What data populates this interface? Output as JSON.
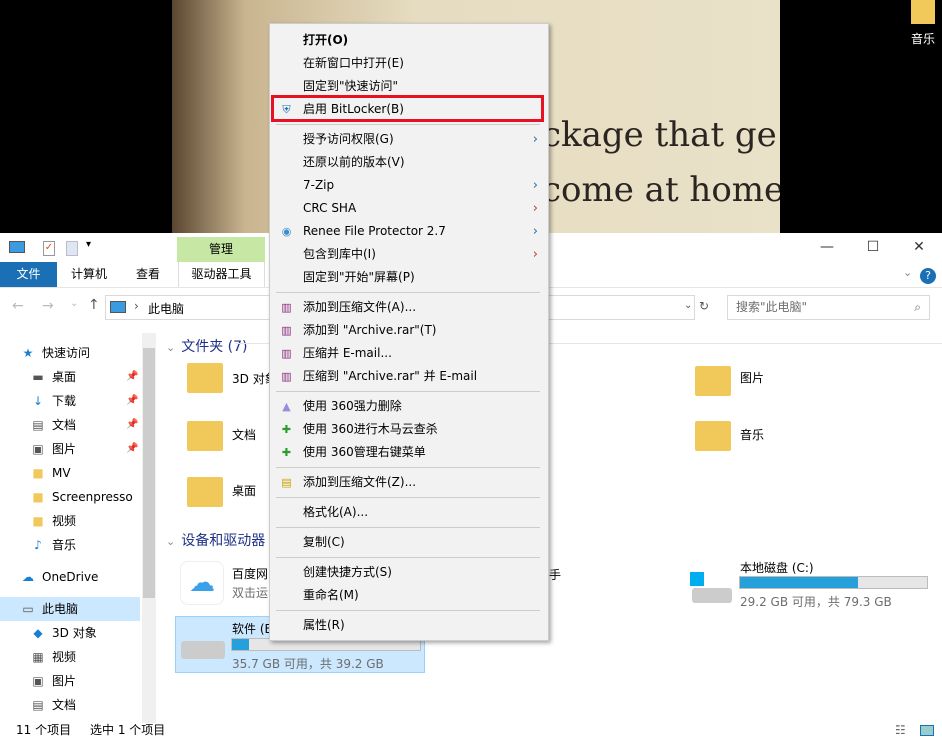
{
  "desktop": {
    "photo_text_1": "ckage that ge",
    "photo_text_2": "come at home",
    "icon_label": "音乐"
  },
  "window": {
    "ribbon": {
      "context_tab": "管理",
      "tabs": [
        "文件",
        "计算机",
        "查看",
        "驱动器工具"
      ]
    },
    "address": {
      "path": "此电脑",
      "search_placeholder": "搜索\"此电脑\""
    },
    "nav": [
      {
        "label": "快速访问",
        "icon": "star-icon"
      },
      {
        "label": "桌面",
        "icon": "desktop-icon",
        "pinned": true
      },
      {
        "label": "下载",
        "icon": "download-icon",
        "pinned": true
      },
      {
        "label": "文档",
        "icon": "document-icon",
        "pinned": true
      },
      {
        "label": "图片",
        "icon": "picture-icon",
        "pinned": true
      },
      {
        "label": "MV",
        "icon": "folder-icon"
      },
      {
        "label": "Screenpresso",
        "icon": "folder-icon"
      },
      {
        "label": "视频",
        "icon": "folder-icon"
      },
      {
        "label": "音乐",
        "icon": "music-icon"
      },
      {
        "label": "OneDrive",
        "icon": "cloud-icon"
      },
      {
        "label": "此电脑",
        "icon": "computer-icon",
        "selected": true
      },
      {
        "label": "3D 对象",
        "icon": "cube-icon"
      },
      {
        "label": "视频",
        "icon": "video-icon"
      },
      {
        "label": "图片",
        "icon": "picture-icon"
      },
      {
        "label": "文档",
        "icon": "document-icon"
      }
    ],
    "folders_header": "文件夹 (7)",
    "folders": [
      {
        "label": "3D 对象"
      },
      {
        "label": "文档"
      },
      {
        "label": "桌面"
      },
      {
        "label": "图片"
      },
      {
        "label": "音乐"
      }
    ],
    "devices_header": "设备和驱动器",
    "devices": [
      {
        "label": "百度网",
        "sub": "双击运"
      },
      {
        "label": "软件 (E",
        "sub": "35.7 GB 可用，共 39.2 GB",
        "used_percent": 9
      },
      {
        "label": "手"
      },
      {
        "label": "本地磁盘 (C:)",
        "sub": "29.2 GB 可用，共 79.3 GB",
        "used_percent": 63
      }
    ],
    "status": {
      "count": "11 个项目",
      "selected": "选中 1 个项目"
    }
  },
  "menu": {
    "items": [
      {
        "label": "打开(O)",
        "bold": true
      },
      {
        "label": "在新窗口中打开(E)"
      },
      {
        "label": "固定到\"快速访问\""
      },
      {
        "label": "启用 BitLocker(B)",
        "icon": "shield-icon",
        "highlighted": true
      },
      {
        "sep": true
      },
      {
        "label": "授予访问权限(G)",
        "submenu": true
      },
      {
        "label": "还原以前的版本(V)"
      },
      {
        "label": "7-Zip",
        "submenu": true
      },
      {
        "label": "CRC SHA",
        "submenu": true,
        "red": true
      },
      {
        "label": "Renee File Protector 2.7",
        "icon": "renee-icon",
        "submenu": true
      },
      {
        "label": "包含到库中(I)",
        "submenu": true,
        "red": true
      },
      {
        "label": "固定到\"开始\"屏幕(P)"
      },
      {
        "sep": true
      },
      {
        "label": "添加到压缩文件(A)...",
        "icon": "winrar-icon"
      },
      {
        "label": "添加到 \"Archive.rar\"(T)",
        "icon": "winrar-icon"
      },
      {
        "label": "压缩并 E-mail...",
        "icon": "winrar-icon"
      },
      {
        "label": "压缩到 \"Archive.rar\" 并 E-mail",
        "icon": "winrar-icon"
      },
      {
        "sep": true
      },
      {
        "label": "使用 360强力删除",
        "icon": "360-delete-icon"
      },
      {
        "label": "使用 360进行木马云查杀",
        "icon": "360-icon"
      },
      {
        "label": "使用 360管理右键菜单",
        "icon": "360-icon"
      },
      {
        "sep": true
      },
      {
        "label": "添加到压缩文件(Z)...",
        "icon": "archive-icon"
      },
      {
        "sep": true
      },
      {
        "label": "格式化(A)..."
      },
      {
        "sep": true
      },
      {
        "label": "复制(C)"
      },
      {
        "sep": true
      },
      {
        "label": "创建快捷方式(S)"
      },
      {
        "label": "重命名(M)"
      },
      {
        "sep": true
      },
      {
        "label": "属性(R)"
      }
    ]
  },
  "colors": {
    "accent": "#1a6fb5",
    "manage_tab": "#c7e7a5",
    "selection": "#cce8ff",
    "bar": "#26a0da",
    "highlight_box": "#e81123"
  }
}
